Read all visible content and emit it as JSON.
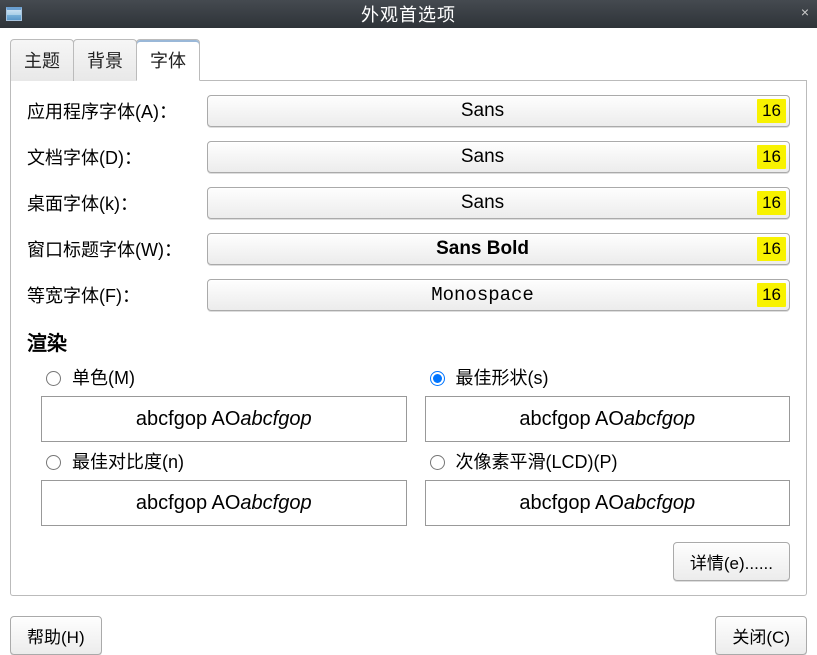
{
  "window": {
    "title": "外观首选项",
    "close_glyph": "×"
  },
  "tabs": {
    "theme": "主题",
    "background": "背景",
    "font": "字体"
  },
  "fonts": {
    "app": {
      "label": "应用程序字体(A)：",
      "name": "Sans",
      "size": "16"
    },
    "doc": {
      "label": "文档字体(D)：",
      "name": "Sans",
      "size": "16"
    },
    "desk": {
      "label": "桌面字体(k)：",
      "name": "Sans",
      "size": "16"
    },
    "title": {
      "label": "窗口标题字体(W)：",
      "name": "Sans Bold",
      "size": "16"
    },
    "mono": {
      "label": "等宽字体(F)：",
      "name": "Monospace",
      "size": "16"
    }
  },
  "rendering": {
    "heading": "渲染",
    "monochrome": "单色(M)",
    "best_shapes": "最佳形状(s)",
    "best_contrast": "最佳对比度(n)",
    "subpixel": "次像素平滑(LCD)(P)",
    "sample_regular": "abcfgop AO ",
    "sample_italic": "abcfgop",
    "selected": "best_shapes"
  },
  "buttons": {
    "details": "详情(e)......",
    "help": "帮助(H)",
    "close": "关闭(C)"
  }
}
